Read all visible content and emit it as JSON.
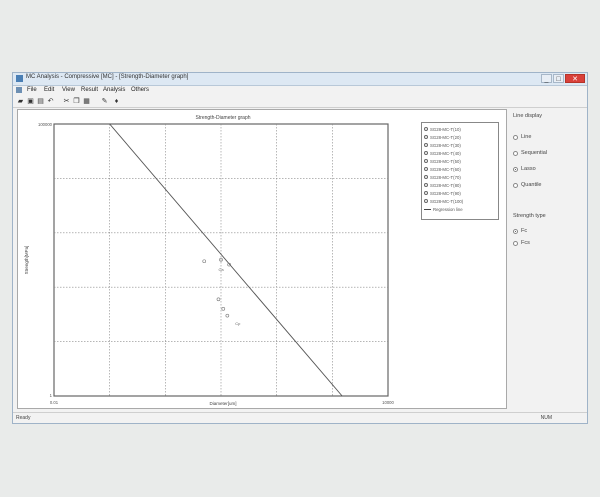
{
  "window": {
    "title": "MC Analysis - Compressive [MC] - [Strength-Diameter graph]",
    "buttons": [
      "_",
      "□",
      "✕"
    ]
  },
  "menu": [
    "File",
    "Edit",
    "View",
    "Result",
    "Analysis",
    "Others"
  ],
  "toolbar": [
    "open",
    "save",
    "print",
    "undo",
    "cut",
    "copy",
    "paste",
    "tool",
    "info"
  ],
  "legend": {
    "items": [
      "SG28-MC-T(10)",
      "SG28-MC-T(20)",
      "SG28-MC-T(30)",
      "SG28-MC-T(40)",
      "SG28-MC-T(50)",
      "SG28-MC-T(60)",
      "SG28-MC-T(70)",
      "SG28-MC-T(80)",
      "SG28-MC-T(90)",
      "SG28-MC-T(100)"
    ],
    "line_item": "Regression line"
  },
  "right_panel": {
    "line_mode_title": "Line display",
    "line_modes": [
      "Line",
      "Sequential",
      "Lasso",
      "Quantile"
    ],
    "line_mode_selected": 2,
    "strength_type_title": "Strength type",
    "strength_types": [
      "Fc",
      "Fcs"
    ],
    "strength_type_selected": 0
  },
  "status": {
    "left": "Ready",
    "right": "NUM"
  },
  "chart_data": {
    "type": "scatter",
    "title": "Strength-Diameter graph",
    "xlabel": "Diameter[um]",
    "ylabel": "Strength[MPa]",
    "xscale": "log",
    "yscale": "log",
    "xlim": [
      0.01,
      10000
    ],
    "ylim": [
      1,
      100000
    ],
    "x_tick_labels": [
      "0.01",
      "10000"
    ],
    "y_tick_labels": [
      "100000",
      "1"
    ],
    "grid": true,
    "legend_placement": "right",
    "point_labels": [
      "Ca",
      "Cp"
    ],
    "series": [
      {
        "x": [
          5,
          10,
          14
        ],
        "y": [
          300,
          320,
          260
        ]
      },
      {
        "x": [
          9,
          11,
          13
        ],
        "y": [
          60,
          40,
          30
        ]
      }
    ],
    "regression_line": {
      "x": [
        0.1,
        1500
      ],
      "y": [
        100000,
        1
      ]
    }
  }
}
